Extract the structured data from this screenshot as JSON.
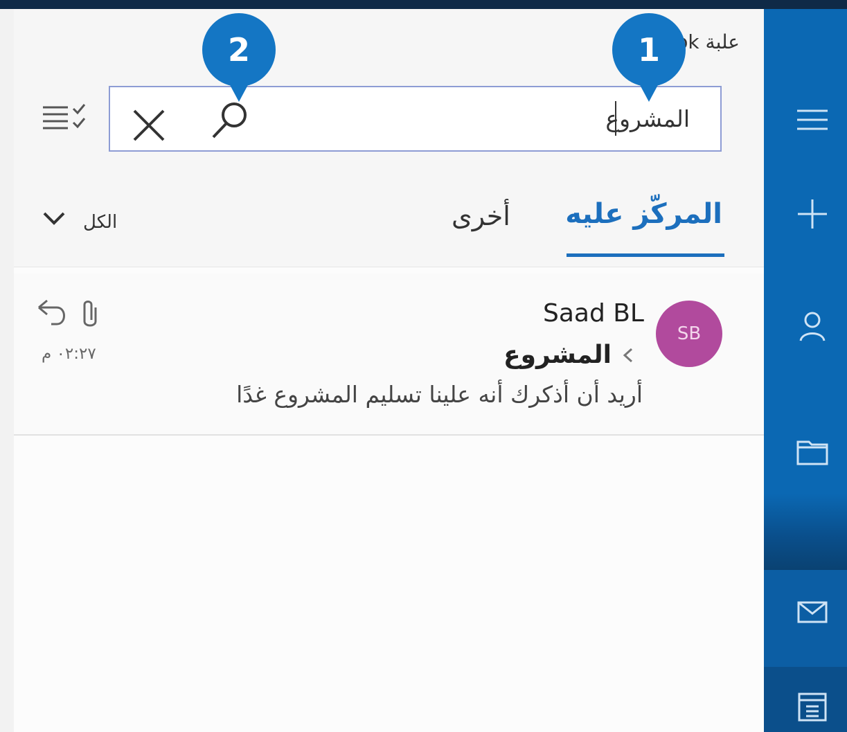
{
  "app": {
    "title": "علبة Outlook"
  },
  "search": {
    "value": "المشروع"
  },
  "tabs": {
    "focused": "المركّز عليه",
    "other": "أخرى",
    "filter": "الكل"
  },
  "message": {
    "avatar_initials": "SB",
    "avatar_color": "#b14a9d",
    "sender": "Saad BL",
    "subject": "المشروع",
    "preview": "أريد أن أذكرك أنه علينا تسليم المشروع غدًا",
    "time": "٠٢:٢٧ م"
  },
  "callouts": {
    "one": "1",
    "two": "2"
  },
  "icons": {
    "rail": [
      "hamburger-icon",
      "plus-icon",
      "person-icon",
      "folder-icon",
      "mail-icon",
      "calendar-icon"
    ],
    "toolbar": [
      "search-icon",
      "close-icon",
      "filter-list-icon",
      "chevron-down-icon"
    ],
    "message": [
      "reply-icon",
      "paperclip-icon",
      "chevron-left-icon"
    ]
  },
  "colors": {
    "rail": "#0b68b3",
    "accent": "#1c6fbd",
    "callout": "#1476c4"
  }
}
